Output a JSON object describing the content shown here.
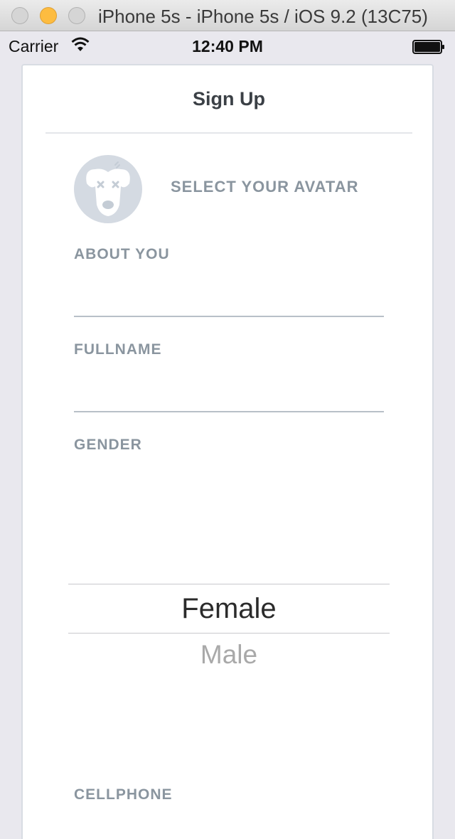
{
  "window": {
    "title": "iPhone 5s - iPhone 5s / iOS 9.2 (13C75)"
  },
  "status_bar": {
    "carrier": "Carrier",
    "time": "12:40 PM"
  },
  "nav": {
    "title": "Sign Up"
  },
  "avatar": {
    "label": "SELECT YOUR AVATAR",
    "icon": "dog-face-icon"
  },
  "form": {
    "about_label": "ABOUT YOU",
    "fullname_label": "FULLNAME",
    "gender_label": "GENDER",
    "cellphone_label": "CELLPHONE"
  },
  "gender_picker": {
    "selected": "Female",
    "options": [
      "Female",
      "Male"
    ],
    "next_option": "Male"
  },
  "colors": {
    "label": "#8a959f",
    "avatar_bg": "#d4dae2",
    "minimize": "#fdbc40"
  }
}
